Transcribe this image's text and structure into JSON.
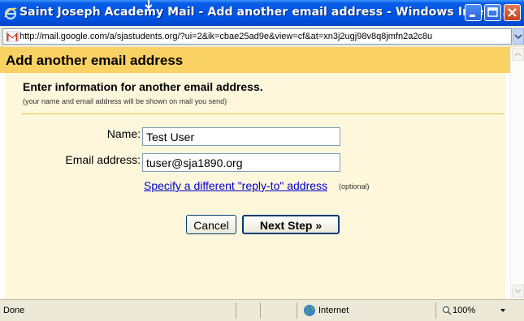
{
  "window": {
    "title": "Saint Joseph Academy Mail - Add another email address - Windows Intern...",
    "title_bar_color": "#0054e3",
    "buttons": [
      "minimize-icon",
      "maximize-icon",
      "close-icon"
    ]
  },
  "address_bar": {
    "url": "http://mail.google.com/a/sjastudents.org/?ui=2&ik=cbae25ad9e&view=cf&at=xn3j2ugj98v8q8jmfn2a2c8u",
    "icon": "gmail-icon"
  },
  "dialog": {
    "heading": "Add another email address",
    "instruction": "Enter information for another email address.",
    "subtext": "(your name and email address will be shown on mail you send)",
    "name_label": "Name:",
    "name_value": "Test User",
    "email_label": "Email address:",
    "email_value": "tuser@sja1890.org",
    "reply_to_link": "Specify a different \"reply-to\" address",
    "optional": "(optional)",
    "cancel_label": "Cancel",
    "next_label": "Next Step »",
    "header_color": "#fad163",
    "panel_color": "#fef7dc",
    "link_color": "#0000cc"
  },
  "status_bar": {
    "status": "Done",
    "zone": "Internet",
    "zoom": "100%"
  }
}
